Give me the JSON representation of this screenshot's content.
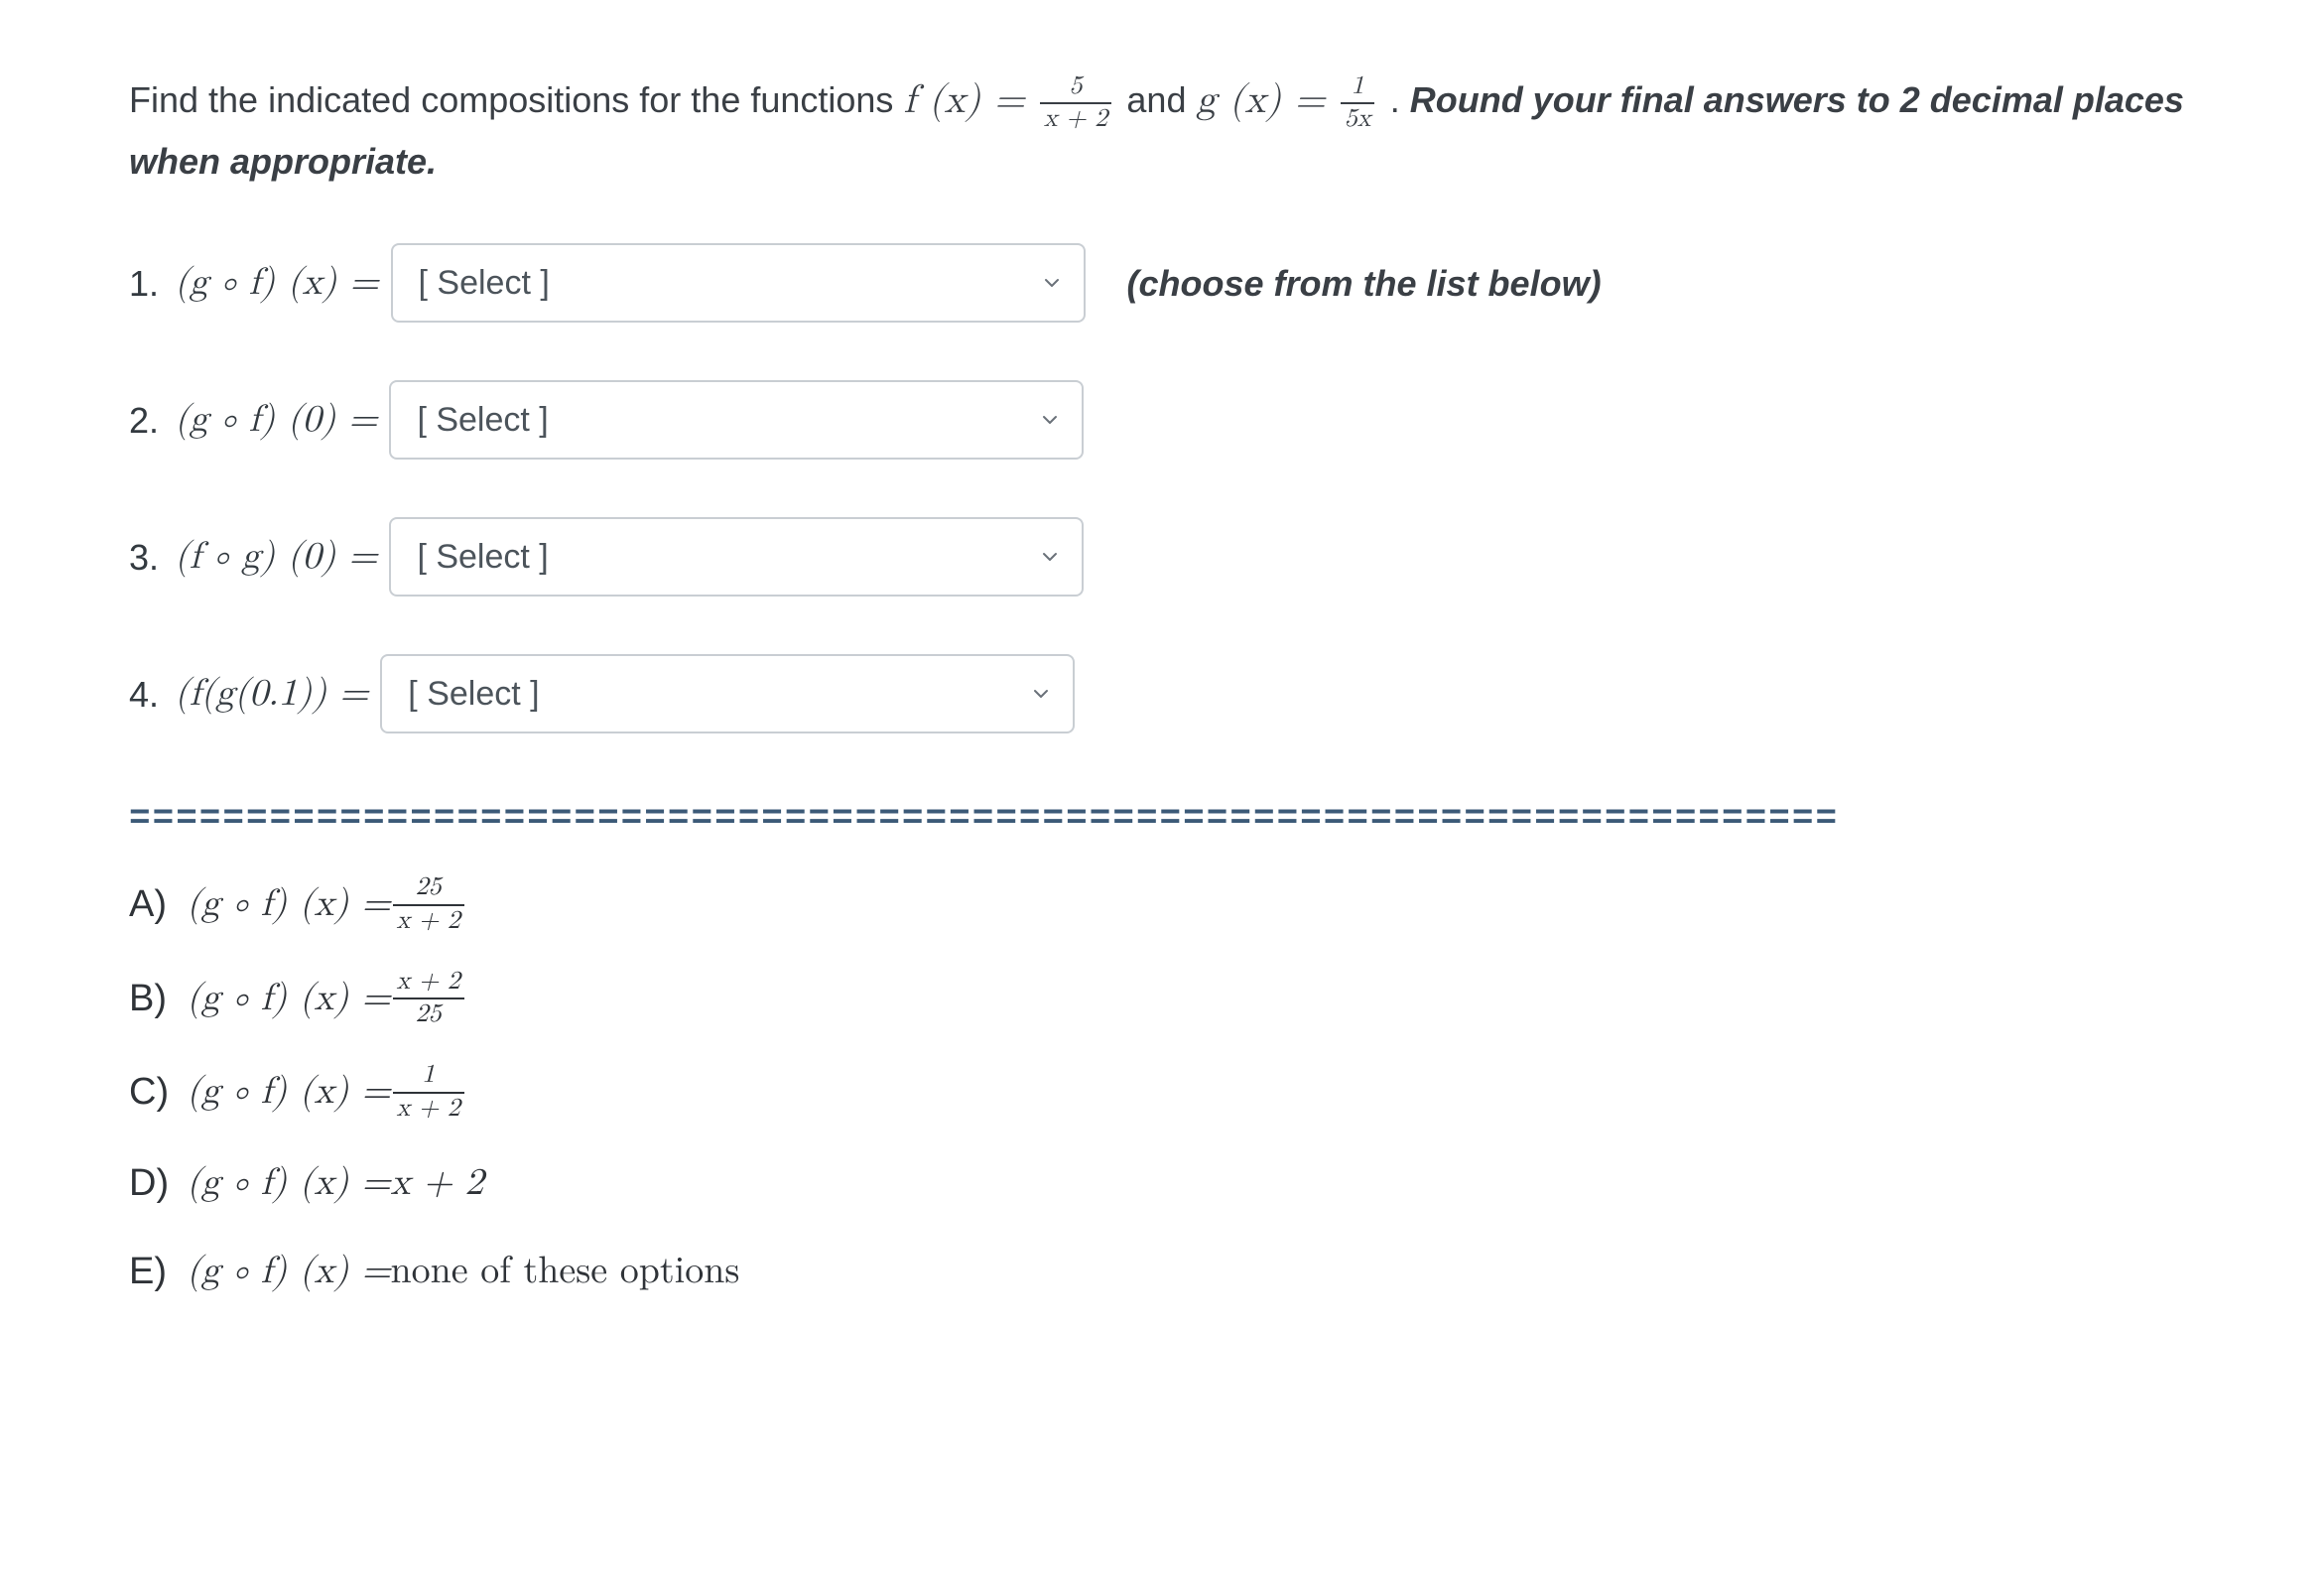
{
  "intro": {
    "lead": "Find the indicated compositions for the functions ",
    "f_label": "f (x) = ",
    "f_num": "5",
    "f_den": "x + 2",
    "mid": " and ",
    "g_label": "g (x) = ",
    "g_num": "1",
    "g_den": "5x",
    "period": ".   ",
    "round": "Round your final answers to 2 decimal places when appropriate."
  },
  "select_placeholder": "[ Select ]",
  "hint": "(choose from the list below)",
  "questions": [
    {
      "num": "1.",
      "lhs_fn": "(g ∘ f) (x) ="
    },
    {
      "num": "2.",
      "lhs_fn": "(g ∘ f) (0) ="
    },
    {
      "num": "3.",
      "lhs_fn": "(f ∘ g) (0) ="
    },
    {
      "num": "4.",
      "lhs_fn": "(f(g(0.1)) ="
    }
  ],
  "divider": "=========================================================================",
  "options": [
    {
      "letter": "A)",
      "lhs": "(g ∘ f) (x) = ",
      "rhs_type": "frac",
      "rhs_num": "25",
      "rhs_den": "x + 2"
    },
    {
      "letter": "B)",
      "lhs": "(g ∘ f) (x) = ",
      "rhs_type": "frac",
      "rhs_num": "x + 2",
      "rhs_den": "25"
    },
    {
      "letter": "C)",
      "lhs": "(g ∘ f) (x) = ",
      "rhs_type": "frac",
      "rhs_num": "1",
      "rhs_den": "x + 2"
    },
    {
      "letter": "D)",
      "lhs": "(g ∘ f) (x) = ",
      "rhs_type": "text",
      "rhs_text": "x + 2"
    },
    {
      "letter": "E)",
      "lhs": "(g ∘ f) (x) = ",
      "rhs_type": "text",
      "rhs_text": "none of these options"
    }
  ]
}
